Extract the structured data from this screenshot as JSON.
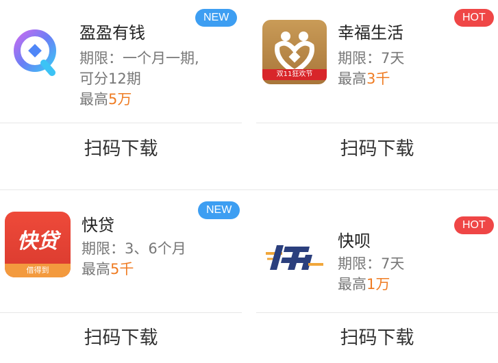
{
  "download_label": "扫码下载",
  "colors": {
    "accent_orange": "#ef7b22",
    "badge_new": "#3d9ef2",
    "badge_hot": "#ef4646"
  },
  "cards": [
    {
      "name": "盈盈有钱",
      "badge": "NEW",
      "icon": "yingying-logo-icon",
      "desc_lines": [
        "期限：一个月一期,",
        "可分12期"
      ],
      "max_prefix": "最高",
      "max_amount": "5万"
    },
    {
      "name": "幸福生活",
      "badge": "HOT",
      "icon": "xingfu-logo-icon",
      "icon_text": "双11狂欢节",
      "desc_lines": [
        "期限：7天"
      ],
      "max_prefix": "最高",
      "max_amount": "3千"
    },
    {
      "name": "快贷",
      "badge": "NEW",
      "icon": "kuaidai-logo-icon",
      "icon_text": "快贷",
      "icon_subtext": "借得到",
      "desc_lines": [
        "期限：3、6个月"
      ],
      "max_prefix": "最高",
      "max_amount": "5千"
    },
    {
      "name": "快呗",
      "badge": "HOT",
      "icon": "kuaibei-logo-icon",
      "desc_lines": [
        "期限：7天"
      ],
      "max_prefix": "最高",
      "max_amount": "1万"
    }
  ]
}
